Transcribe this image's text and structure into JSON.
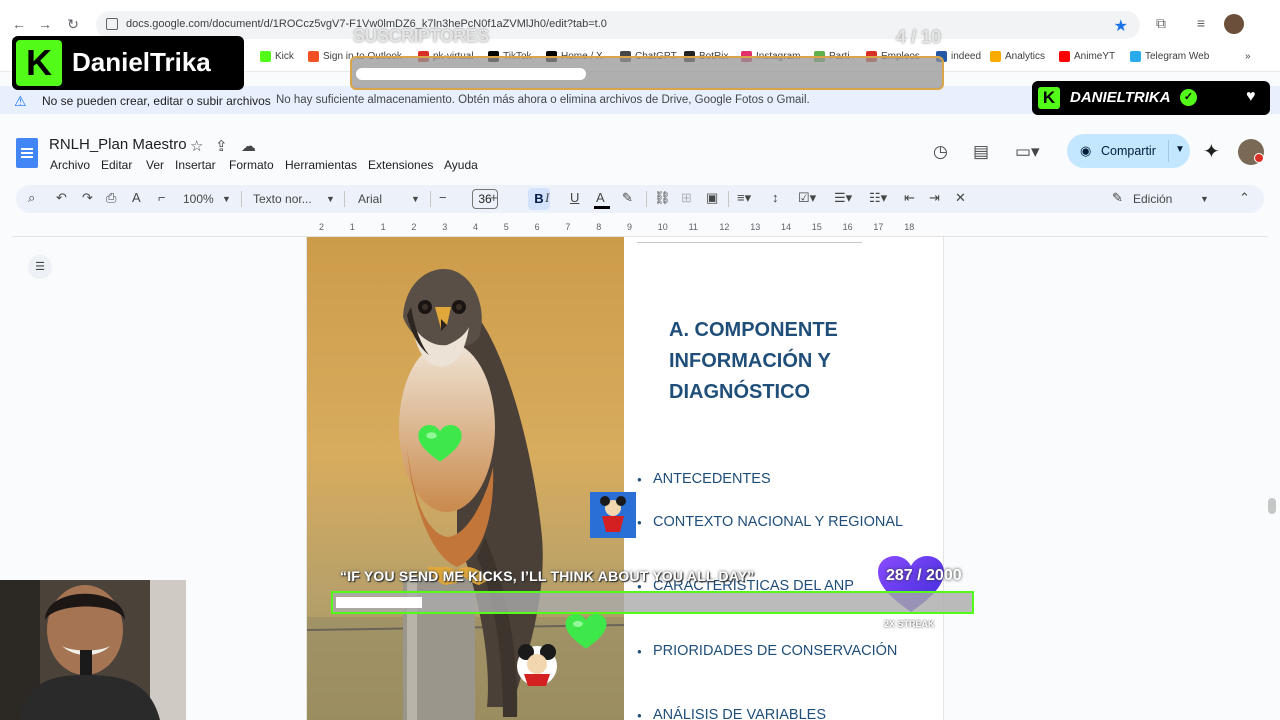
{
  "browser": {
    "url": "docs.google.com/document/d/1ROCcz5vgV7-F1Vw0lmDZ6_k7ln3hePcN0f1aZVMlJh0/edit?tab=t.0",
    "bookmarks": [
      {
        "label": "Kick",
        "color": "#53fc18"
      },
      {
        "label": "Sign in to Outlook",
        "color": "#f25022"
      },
      {
        "label": "pk-virtual",
        "color": "#d93025"
      },
      {
        "label": "TikTok",
        "color": "#000000"
      },
      {
        "label": "Home / X",
        "color": "#000000"
      },
      {
        "label": "ChatGPT",
        "color": "#444746"
      },
      {
        "label": "BotRix",
        "color": "#222222"
      },
      {
        "label": "Instagram",
        "color": "#e1306c"
      },
      {
        "label": "Parti",
        "color": "#5fb24a"
      },
      {
        "label": "Empleos",
        "color": "#d93025"
      },
      {
        "label": "indeed",
        "color": "#2557a7"
      },
      {
        "label": "Analytics",
        "color": "#f9ab00"
      },
      {
        "label": "AnimeYT",
        "color": "#ff0000"
      },
      {
        "label": "Telegram Web",
        "color": "#2aabee"
      }
    ]
  },
  "warning": {
    "title": "No se pueden crear, editar o subir archivos",
    "message": "No hay suficiente almacenamiento. Obtén más ahora o elimina archivos de Drive, Google Fotos o Gmail."
  },
  "docs": {
    "title": "RNLH_Plan Maestro",
    "menu": [
      "Archivo",
      "Editar",
      "Ver",
      "Insertar",
      "Formato",
      "Herramientas",
      "Extensiones",
      "Ayuda"
    ],
    "share_label": "Compartir",
    "toolbar": {
      "zoom": "100%",
      "style": "Texto nor...",
      "font": "Arial",
      "font_size": "36",
      "mode": "Edición"
    },
    "ruler": [
      "2",
      "1",
      "1",
      "2",
      "3",
      "4",
      "5",
      "6",
      "7",
      "8",
      "9",
      "10",
      "11",
      "12",
      "13",
      "14",
      "15",
      "16",
      "17",
      "18"
    ]
  },
  "page": {
    "section_title": "A. COMPONENTE INFORMACIÓN Y DIAGNÓSTICO",
    "bullets": [
      "ANTECEDENTES",
      "CONTEXTO NACIONAL Y REGIONAL",
      "CARACTERÍSTICAS DEL ANP",
      "PRIORIDADES DE CONSERVACIÓN",
      "ANÁLISIS DE VARIABLES"
    ]
  },
  "overlay": {
    "brand": "DanielTrika",
    "brand_badge": "DANIELTRIKA",
    "subs_label": "SUSCRIPTORES",
    "subs_count": "4 / 10",
    "kicks_text": "“IF YOU SEND ME KICKS, I’LL THINK ABOUT YOU ALL DAY”",
    "kicks_count": "287 / 2000",
    "streak": "2X STREAK",
    "accent": "#53fc18"
  }
}
